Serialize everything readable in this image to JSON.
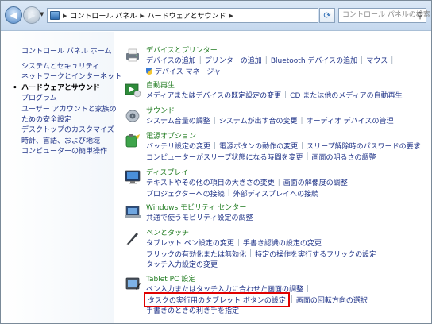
{
  "address_bar": {
    "back_icon": "back-arrow-icon",
    "forward_icon": "forward-arrow-icon",
    "breadcrumbs": [
      "コントロール パネル",
      "ハードウェアとサウンド"
    ],
    "search_placeholder": "コントロール パネルの検索"
  },
  "sidebar": {
    "home": "コントロール パネル ホーム",
    "items": [
      "システムとセキュリティ",
      "ネットワークとインターネット",
      "ハードウェアとサウンド",
      "プログラム",
      "ユーザー アカウントと家族の",
      "ための安全設定",
      "デスクトップのカスタマイズ",
      "時計、言語、および地域",
      "コンピューターの簡単操作"
    ],
    "current": "ハードウェアとサウンド"
  },
  "categories": {
    "devices": {
      "title": "デバイスとプリンター",
      "links": [
        "デバイスの追加",
        "プリンターの追加",
        "Bluetooth デバイスの追加",
        "マウス",
        "デバイス マネージャー"
      ]
    },
    "autoplay": {
      "title": "自動再生",
      "links": [
        "メディアまたはデバイスの既定設定の変更",
        "CD または他のメディアの自動再生"
      ]
    },
    "sound": {
      "title": "サウンド",
      "links": [
        "システム音量の調整",
        "システムが出す音の変更",
        "オーディオ デバイスの管理"
      ]
    },
    "power": {
      "title": "電源オプション",
      "links": [
        "バッテリ設定の変更",
        "電源ボタンの動作の変更",
        "スリープ解除時のパスワードの要求",
        "コンピューターがスリープ状態になる時間を変更",
        "画面の明るさの調整"
      ]
    },
    "display": {
      "title": "ディスプレイ",
      "links": [
        "テキストやその他の項目の大きさの変更",
        "画面の解像度の調整",
        "プロジェクターへの接続",
        "外部ディスプレイへの接続"
      ]
    },
    "mobility": {
      "title": "Windows モビリティ センター",
      "links": [
        "共通で使うモビリティ設定の調整"
      ]
    },
    "pen": {
      "title": "ペンとタッチ",
      "links": [
        "タブレット ペン設定の変更",
        "手書き認識の設定の変更",
        "フリックの有効化または無効化",
        "特定の操作を実行するフリックの設定",
        "タッチ入力設定の変更"
      ]
    },
    "tablet": {
      "title": "Tablet PC 設定",
      "links": [
        "ペン入力またはタッチ入力に合わせた画面の調整",
        "タスクの実行用のタブレット ボタンの設定",
        "画面の回転方向の選択",
        "手書きのときの利き手を指定"
      ]
    }
  },
  "highlight_color": "#e00000"
}
